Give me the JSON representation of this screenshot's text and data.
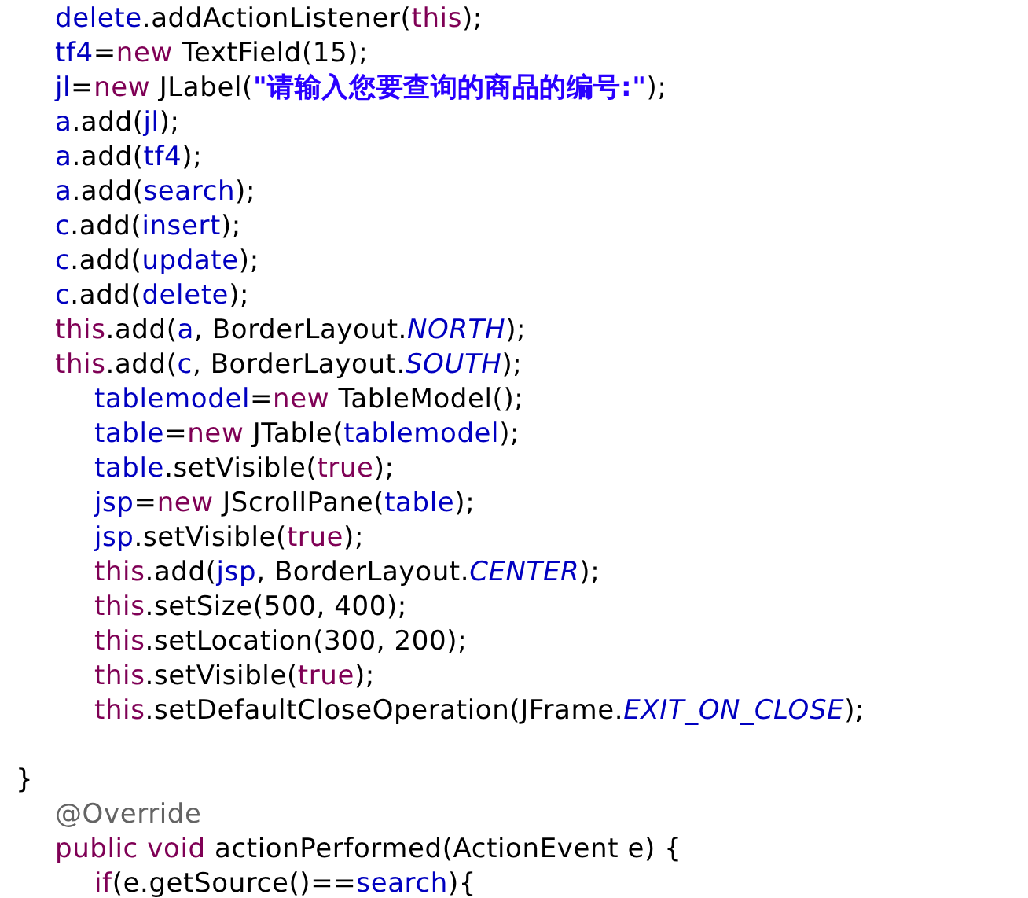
{
  "code": [
    {
      "children": [
        {
          "tokens": [
            {
              "text": "delete",
              "kind": "field"
            },
            {
              "text": ".addActionListener(",
              "kind": "plain"
            },
            {
              "text": "this",
              "kind": "keyword"
            },
            {
              "text": ");",
              "kind": "plain"
            }
          ]
        },
        {
          "tokens": [
            {
              "text": "tf4",
              "kind": "field"
            },
            {
              "text": "=",
              "kind": "plain"
            },
            {
              "text": "new",
              "kind": "keyword"
            },
            {
              "text": " TextField(15);",
              "kind": "plain"
            }
          ]
        },
        {
          "tokens": [
            {
              "text": "jl",
              "kind": "field"
            },
            {
              "text": "=",
              "kind": "plain"
            },
            {
              "text": "new",
              "kind": "keyword"
            },
            {
              "text": " JLabel(",
              "kind": "plain"
            },
            {
              "text": "\"请输入您要查询的商品的编号:\"",
              "kind": "string"
            },
            {
              "text": ");",
              "kind": "plain"
            }
          ]
        },
        {
          "tokens": [
            {
              "text": "a",
              "kind": "field"
            },
            {
              "text": ".add(",
              "kind": "plain"
            },
            {
              "text": "jl",
              "kind": "field"
            },
            {
              "text": ");",
              "kind": "plain"
            }
          ]
        },
        {
          "tokens": [
            {
              "text": "a",
              "kind": "field"
            },
            {
              "text": ".add(",
              "kind": "plain"
            },
            {
              "text": "tf4",
              "kind": "field"
            },
            {
              "text": ");",
              "kind": "plain"
            }
          ]
        },
        {
          "tokens": [
            {
              "text": "a",
              "kind": "field"
            },
            {
              "text": ".add(",
              "kind": "plain"
            },
            {
              "text": "search",
              "kind": "field"
            },
            {
              "text": ");",
              "kind": "plain"
            }
          ]
        },
        {
          "tokens": [
            {
              "text": "c",
              "kind": "field"
            },
            {
              "text": ".add(",
              "kind": "plain"
            },
            {
              "text": "insert",
              "kind": "field"
            },
            {
              "text": ");",
              "kind": "plain"
            }
          ]
        },
        {
          "tokens": [
            {
              "text": "c",
              "kind": "field"
            },
            {
              "text": ".add(",
              "kind": "plain"
            },
            {
              "text": "update",
              "kind": "field"
            },
            {
              "text": ");",
              "kind": "plain"
            }
          ]
        },
        {
          "tokens": [
            {
              "text": "c",
              "kind": "field"
            },
            {
              "text": ".add(",
              "kind": "plain"
            },
            {
              "text": "delete",
              "kind": "field"
            },
            {
              "text": ");",
              "kind": "plain"
            }
          ]
        },
        {
          "tokens": [
            {
              "text": "this",
              "kind": "keyword"
            },
            {
              "text": ".add(",
              "kind": "plain"
            },
            {
              "text": "a",
              "kind": "field"
            },
            {
              "text": ", BorderLayout.",
              "kind": "plain"
            },
            {
              "text": "NORTH",
              "kind": "constant"
            },
            {
              "text": ");",
              "kind": "plain"
            }
          ]
        },
        {
          "tokens": [
            {
              "text": "this",
              "kind": "keyword"
            },
            {
              "text": ".add(",
              "kind": "plain"
            },
            {
              "text": "c",
              "kind": "field"
            },
            {
              "text": ", BorderLayout.",
              "kind": "plain"
            },
            {
              "text": "SOUTH",
              "kind": "constant"
            },
            {
              "text": ");",
              "kind": "plain"
            }
          ],
          "children": [
            {
              "tokens": [
                {
                  "text": "tablemodel",
                  "kind": "field"
                },
                {
                  "text": "=",
                  "kind": "plain"
                },
                {
                  "text": "new",
                  "kind": "keyword"
                },
                {
                  "text": " TableModel();",
                  "kind": "plain"
                }
              ]
            },
            {
              "tokens": [
                {
                  "text": "table",
                  "kind": "field"
                },
                {
                  "text": "=",
                  "kind": "plain"
                },
                {
                  "text": "new",
                  "kind": "keyword"
                },
                {
                  "text": " JTable(",
                  "kind": "plain"
                },
                {
                  "text": "tablemodel",
                  "kind": "field"
                },
                {
                  "text": ");",
                  "kind": "plain"
                }
              ]
            },
            {
              "tokens": [
                {
                  "text": "table",
                  "kind": "field"
                },
                {
                  "text": ".setVisible(",
                  "kind": "plain"
                },
                {
                  "text": "true",
                  "kind": "keyword"
                },
                {
                  "text": ");",
                  "kind": "plain"
                }
              ]
            },
            {
              "tokens": [
                {
                  "text": "jsp",
                  "kind": "field"
                },
                {
                  "text": "=",
                  "kind": "plain"
                },
                {
                  "text": "new",
                  "kind": "keyword"
                },
                {
                  "text": " JScrollPane(",
                  "kind": "plain"
                },
                {
                  "text": "table",
                  "kind": "field"
                },
                {
                  "text": ");",
                  "kind": "plain"
                }
              ]
            },
            {
              "tokens": [
                {
                  "text": "jsp",
                  "kind": "field"
                },
                {
                  "text": ".setVisible(",
                  "kind": "plain"
                },
                {
                  "text": "true",
                  "kind": "keyword"
                },
                {
                  "text": ");",
                  "kind": "plain"
                }
              ]
            },
            {
              "tokens": [
                {
                  "text": "this",
                  "kind": "keyword"
                },
                {
                  "text": ".add(",
                  "kind": "plain"
                },
                {
                  "text": "jsp",
                  "kind": "field"
                },
                {
                  "text": ", BorderLayout.",
                  "kind": "plain"
                },
                {
                  "text": "CENTER",
                  "kind": "constant"
                },
                {
                  "text": ");",
                  "kind": "plain"
                }
              ]
            },
            {
              "tokens": [
                {
                  "text": "this",
                  "kind": "keyword"
                },
                {
                  "text": ".setSize(500, 400);",
                  "kind": "plain"
                }
              ]
            },
            {
              "tokens": [
                {
                  "text": "this",
                  "kind": "keyword"
                },
                {
                  "text": ".setLocation(300, 200);",
                  "kind": "plain"
                }
              ]
            },
            {
              "tokens": [
                {
                  "text": "this",
                  "kind": "keyword"
                },
                {
                  "text": ".setVisible(",
                  "kind": "plain"
                },
                {
                  "text": "true",
                  "kind": "keyword"
                },
                {
                  "text": ");",
                  "kind": "plain"
                }
              ]
            },
            {
              "tokens": [
                {
                  "text": "this",
                  "kind": "keyword"
                },
                {
                  "text": ".setDefaultCloseOperation(JFrame.",
                  "kind": "plain"
                },
                {
                  "text": "EXIT_ON_CLOSE",
                  "kind": "constant"
                },
                {
                  "text": ");",
                  "kind": "plain"
                }
              ]
            }
          ]
        }
      ]
    },
    {
      "kind": "blank"
    },
    {
      "tokens": [
        {
          "text": "}",
          "kind": "plain"
        }
      ]
    },
    {
      "children": [
        {
          "tokens": [
            {
              "text": "@Override",
              "kind": "annotation"
            }
          ]
        },
        {
          "tokens": [
            {
              "text": "public void",
              "kind": "keyword"
            },
            {
              "text": " actionPerformed(ActionEvent e) {",
              "kind": "plain"
            }
          ],
          "children": [
            {
              "tokens": [
                {
                  "text": "if",
                  "kind": "keyword"
                },
                {
                  "text": "(e.getSource()==",
                  "kind": "plain"
                },
                {
                  "text": "search",
                  "kind": "field"
                },
                {
                  "text": "){",
                  "kind": "plain"
                }
              ]
            }
          ]
        }
      ]
    }
  ]
}
